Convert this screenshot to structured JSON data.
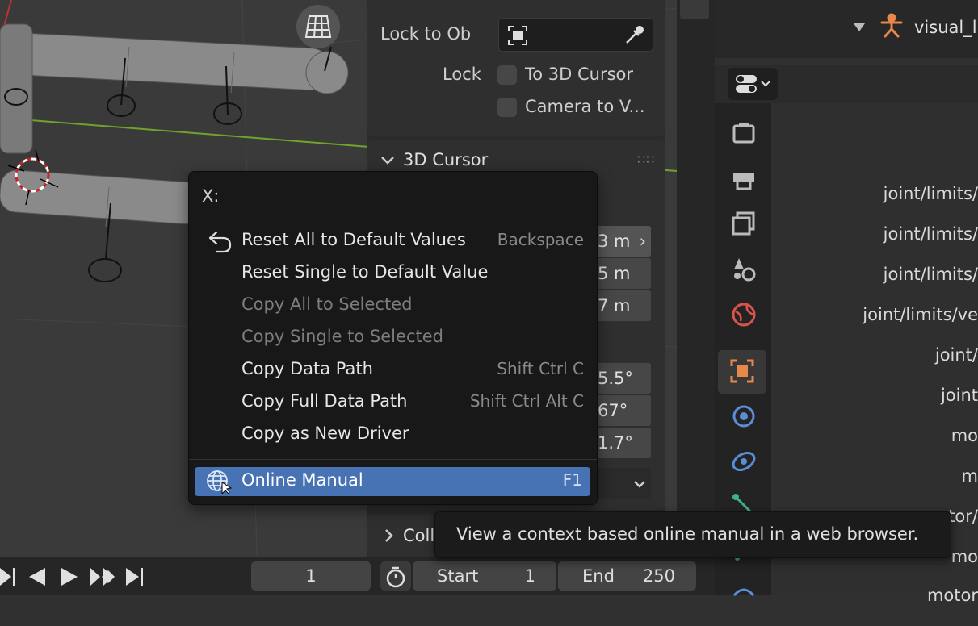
{
  "view_lock": {
    "lock_to_object_label": "Lock to Ob",
    "lock_label": "Lock",
    "to_3d_cursor_label": "To 3D Cursor",
    "camera_to_view_label": "Camera to V..."
  },
  "cursor_panel": {
    "title": "3D Cursor",
    "location_values": [
      "3 m",
      "5 m",
      "7 m"
    ],
    "rotation_values": [
      "5.5°",
      "67°",
      "1.7°"
    ],
    "collapsed_next_label": "Coll"
  },
  "context_menu": {
    "title": "X:",
    "items": [
      {
        "label": "Reset All to Default Values",
        "shortcut": "Backspace",
        "enabled": true
      },
      {
        "label": "Reset Single to Default Value",
        "shortcut": "",
        "enabled": true
      },
      {
        "label": "Copy All to Selected",
        "shortcut": "",
        "enabled": false
      },
      {
        "label": "Copy Single to Selected",
        "shortcut": "",
        "enabled": false
      },
      {
        "label": "Copy Data Path",
        "shortcut": "Shift Ctrl C",
        "enabled": true
      },
      {
        "label": "Copy Full Data Path",
        "shortcut": "Shift Ctrl Alt C",
        "enabled": true
      },
      {
        "label": "Copy as New Driver",
        "shortcut": "",
        "enabled": true
      }
    ],
    "highlighted": {
      "label": "Online Manual",
      "shortcut": "F1"
    }
  },
  "tooltip": {
    "text": "View a context based online manual in a web browser."
  },
  "outliner": {
    "item_label": "visual_l"
  },
  "properties": {
    "labels": [
      "joint/limits/",
      "joint/limits/",
      "joint/limits/",
      "joint/limits/ve",
      "joint/",
      "joint",
      "mo",
      "m",
      "tor/",
      "mo",
      "motor"
    ]
  },
  "timeline": {
    "current_frame": "1",
    "start_label": "Start",
    "start_value": "1",
    "end_label": "End",
    "end_value": "250"
  },
  "colors": {
    "highlight": "#4772b3",
    "menu_bg": "#181818",
    "accent_orange": "#e8884a",
    "axis_green": "#6fa32a"
  }
}
